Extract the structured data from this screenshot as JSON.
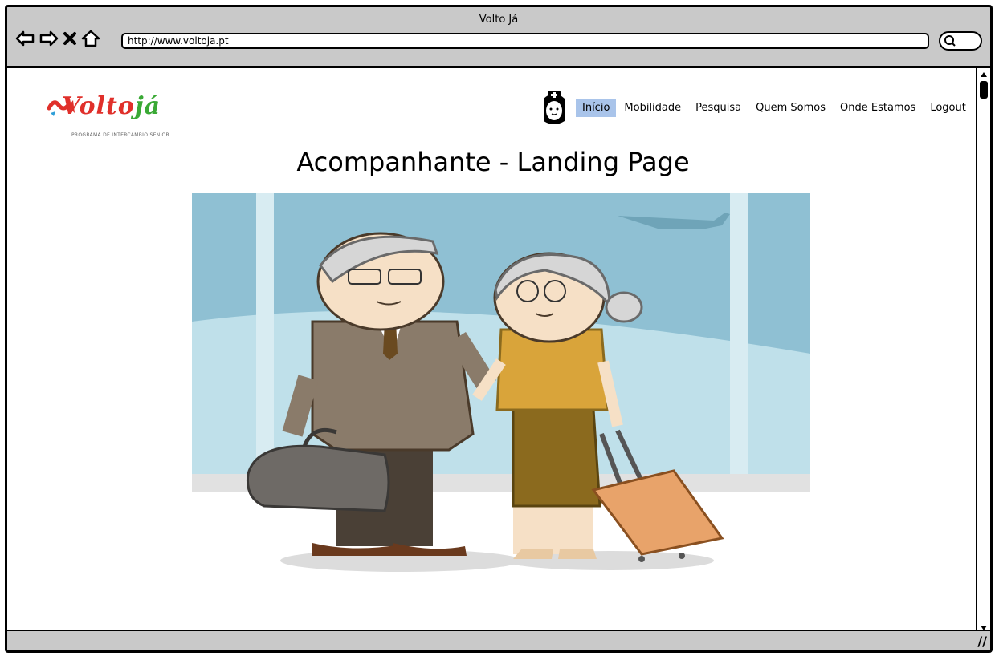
{
  "window": {
    "title": "Volto Já"
  },
  "toolbar": {
    "url": "http://www.voltoja.pt"
  },
  "logo": {
    "text_main": "olto",
    "text_accent": "já",
    "tagline": "PROGRAMA DE INTERCÂMBIO SÉNIOR"
  },
  "nav": {
    "items": [
      {
        "label": "Início",
        "active": true
      },
      {
        "label": "Mobilidade"
      },
      {
        "label": "Pesquisa"
      },
      {
        "label": "Quem Somos"
      },
      {
        "label": "Onde Estamos"
      },
      {
        "label": "Logout"
      }
    ]
  },
  "page": {
    "heading": "Acompanhante - Landing Page"
  },
  "colors": {
    "active_tab": "#a9c4ea",
    "chrome": "#c9c9c9",
    "sky": "#8fc0d3"
  }
}
